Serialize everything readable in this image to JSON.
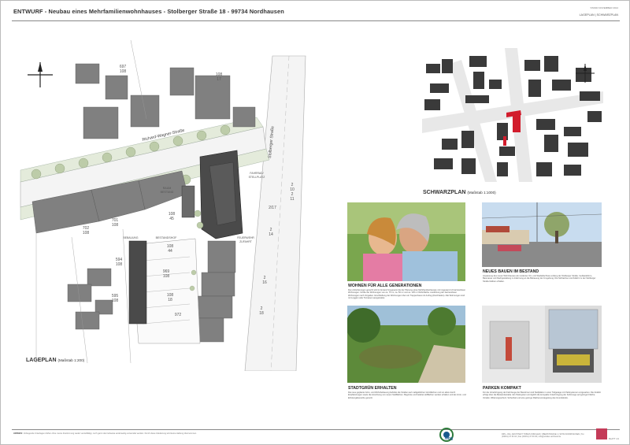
{
  "header": {
    "title": "ENTWURF - Neubau eines Mehrfamilienwohnhauses - Stolberger Straße 18 - 99734 Nordhausen",
    "meta_date": "STAND NOVEMBER 2014",
    "meta_right": "LAGEPLAN | SCHWARZPLAN"
  },
  "lageplan": {
    "title": "LAGEPLAN",
    "scale": "(Maßstab 1:200)",
    "street_richard": "Richard-Wagner-Straße",
    "street_stolberger": "Stolberger Straße",
    "parcels": [
      "697 108",
      "108 17",
      "108 45",
      "701 108",
      "702 108",
      "594 108",
      "969 108",
      "595 108",
      "108 44",
      "108 18",
      "972"
    ],
    "parcel_numbers": [
      "2 10",
      "2 11",
      "2 17",
      "2 14",
      "2 16",
      "2 18"
    ],
    "labels": [
      "RAUM BESTAND",
      "BESTANDSHOF",
      "WOHNEN NEUBAU",
      "BEBAUUNG",
      "FUSSWEG NEUBAU",
      "FAHRRAD/ STELLPLATZ",
      "FEUERWEHR ZUFAHRT"
    ]
  },
  "schwarzplan": {
    "title": "SCHWARZPLAN",
    "scale": "(Maßstab 1:1000)"
  },
  "panels": [
    {
      "title": "WOHNEN FÜR ALLE GENERATIONEN",
      "text": "Den Anforderungen gerecht wird im Entwurf insgesamt die der Planung eines Mehrfamilienhauses mit insgesamt 12 barrierefreien Wohnungen. Größe der Wohnungen von ca. 75 m², ca. 50 m² und ca. 125 m² Wohnfläche. Ausführung der barrierefreien Wohnungen nach Vorgaben. Erschließung der Wohnungen über ein Treppenhaus mit Aufzug (Durchladen). Alle Wohnungen sind mit Loggien oder Terrassen ausgestattet."
    },
    {
      "title": "NEUES BAUEN IM BESTAND",
      "text": "Anpassung des neuen Wohnhauses als moderner Ort- und Stadtabschluss entlang der Stolberger Straße. Gebäudeform, Baumasse und Dachgestaltung in Anlehnung an die Bebauung der Umgebung. Die Sichtachse und Zufahrt zu der Stolberger Straße bleiben erhalten."
    },
    {
      "title": "STADTGRÜN ERHALTEN",
      "text": "Die neue geplante Grün- und Wohnbebauung befindet die Straßen auf maßgeblichen Grünflächen und vor allem durch Einpflanzungen sowie die Anordnung von neuen Stellflächen. Begrünte und belebte Hofflächen werden erhalten und als Grün- und Erholungsbereiche genutzt."
    },
    {
      "title": "PARKEN KOMPAKT",
      "text": "Für die Unterbringung der Fahrzeuge der Bewohner sind Stellplätze in einer Tiefgarage mit Parksystemen vorgesehen. Die Zufahrt erfolgt über die Bestandsstraße. Ein Parksystem ermöglicht die kompakte Unterbringung der Fahrzeuge auf geringer Fläche. Vorteile: Witterungsschutz, Sicherheit und eine geringe Flächenversiegelung des Grundstücks."
    }
  ],
  "footer": {
    "notes_title": "HINWEIS:",
    "notes": "Vorliegende Unterlagen dürfen ohne meine Zustimmung weder vervielfältigt, noch ganz oder teilweise anderweitig verwendet werden. Durch diese Gliederung wird keine Haftung übernommen.",
    "logo_text": "wbg",
    "address": "DIPL.-ING. ARCHITEKT TOBIAS WINKLER | OBERSTRASSE 1 | 99734 NORDHAUSEN | Tel. (03631) 47 60 04 | Fax (03631) 47 60 06 | info@winkler-architekt.de",
    "page": "BLATT 1/1"
  },
  "colors": {
    "building_dark": "#4a4a4a",
    "building_mid": "#808080",
    "street": "#f2f2f2",
    "tree": "#b9c9a9",
    "highlight": "#d21c2c"
  }
}
